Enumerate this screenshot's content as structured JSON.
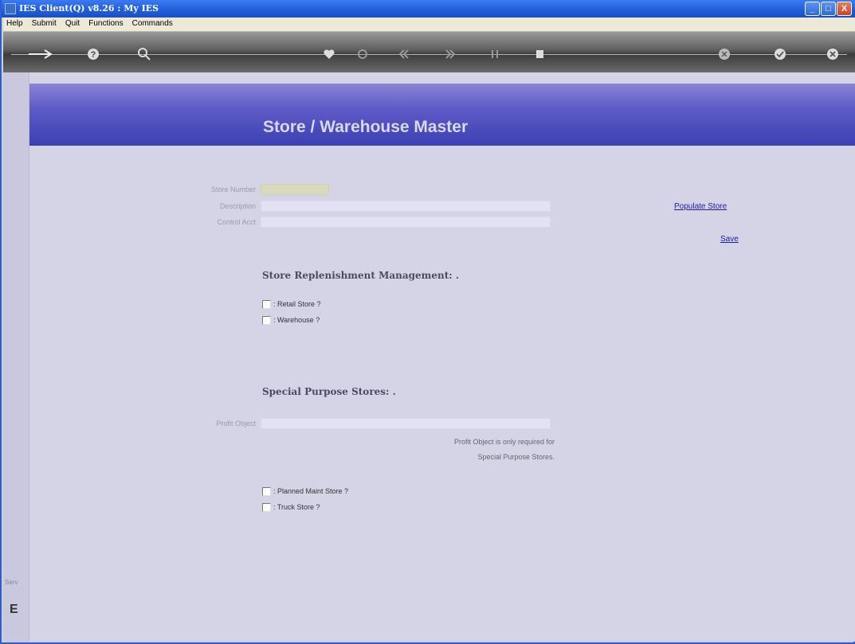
{
  "window": {
    "title": "IES Client(Q) v8.26 : My IES",
    "minimize_label": "_",
    "maximize_label": "□",
    "close_label": "X"
  },
  "menu": [
    "Help",
    "Submit",
    "Quit",
    "Functions",
    "Commands"
  ],
  "toolbar": {
    "icons": [
      "arrow-icon",
      "help-icon",
      "search-icon",
      "heart-icon",
      "refresh-icon",
      "rewind-icon",
      "forward-icon",
      "pause-icon",
      "stop-icon",
      "cancel-icon",
      "check-icon",
      "close-icon"
    ]
  },
  "page": {
    "title": "Store / Warehouse Master",
    "fields": {
      "store_number_label": "Store Number",
      "store_number_value": "",
      "description_label": "Description",
      "description_value": "",
      "control_acct_label": "Control Acct",
      "control_acct_value": "",
      "profit_object_label": "Profit Object",
      "profit_object_value": ""
    },
    "links": {
      "populate_store": "Populate Store",
      "save": "Save"
    },
    "replenishment": {
      "heading": "Store Replenishment Management: .",
      "retail_store": ": Retail Store ?",
      "warehouse": ": Warehouse ?"
    },
    "special": {
      "heading": "Special Purpose Stores: .",
      "note_line1": "Profit Object is only required for",
      "note_line2": "Special Purpose Stores.",
      "planned_maint": ": Planned Maint Store ?",
      "truck_store": ": Truck Store ?"
    }
  },
  "sidebar": {
    "tiny_label": "Serv",
    "big_label": "E"
  },
  "colors": {
    "header_gradient_top": "#8b84d6",
    "header_gradient_bottom": "#3b40b2",
    "background": "#d5d4e7",
    "link": "#1b1bb0"
  }
}
